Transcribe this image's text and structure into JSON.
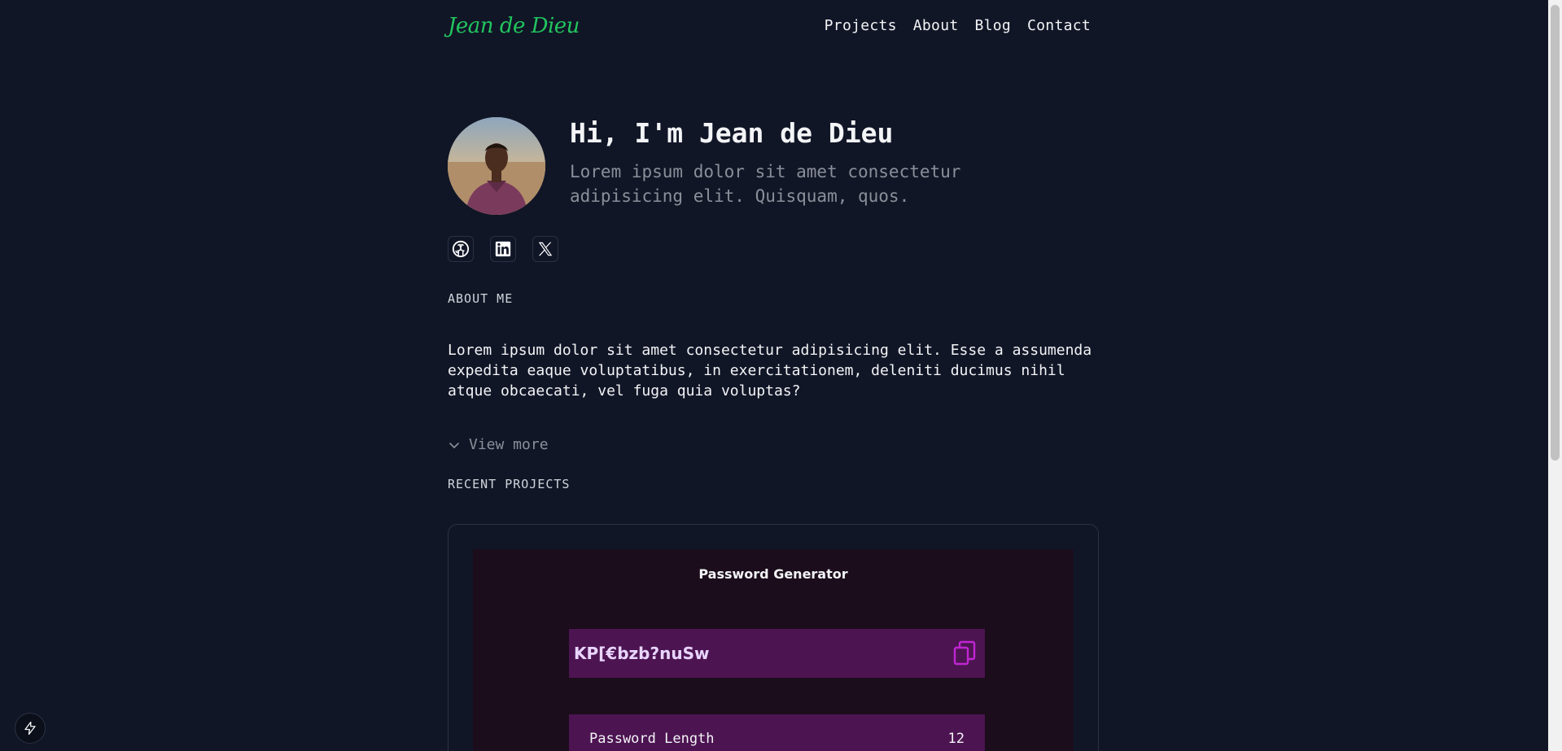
{
  "header": {
    "logo": "Jean de Dieu",
    "nav": [
      "Projects",
      "About",
      "Blog",
      "Contact"
    ]
  },
  "hero": {
    "title": "Hi, I'm Jean de Dieu",
    "subtitle": "Lorem ipsum dolor sit amet consectetur adipisicing elit. Quisquam, quos."
  },
  "socials": [
    "github-icon",
    "linkedin-icon",
    "x-icon"
  ],
  "about": {
    "label": "ABOUT ME",
    "text": "Lorem ipsum dolor sit amet consectetur adipisicing elit. Esse a assumenda expedita eaque voluptatibus, in exercitationem, deleniti ducimus nihil atque obcaecati, vel fuga quia voluptas?",
    "view_more": "View more"
  },
  "projects": {
    "label": "RECENT PROJECTS",
    "preview": {
      "title": "Password Generator",
      "password": "KP[€bzb?nuSw",
      "length_label": "Password Length",
      "length_value": "12"
    }
  },
  "colors": {
    "background": "#111627",
    "accent": "#22c55e",
    "preview_bg": "#1b0d1c",
    "preview_field": "#4d1452",
    "copy_icon": "#c026d3"
  }
}
